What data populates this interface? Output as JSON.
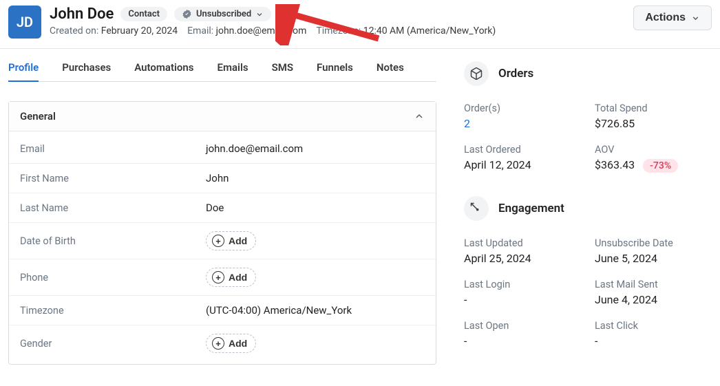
{
  "header": {
    "avatar_initials": "JD",
    "name": "John Doe",
    "badge_contact": "Contact",
    "badge_status": "Unsubscribed",
    "created_label": "Created on:",
    "created_value": "February 20, 2024",
    "email_label": "Email:",
    "email_value": "john.doe@email.com",
    "timezone_label": "Timezone:",
    "timezone_value": "12:40 AM (America/New_York)",
    "actions_label": "Actions"
  },
  "tabs": {
    "profile": "Profile",
    "purchases": "Purchases",
    "automations": "Automations",
    "emails": "Emails",
    "sms": "SMS",
    "funnels": "Funnels",
    "notes": "Notes"
  },
  "general_panel": {
    "title": "General",
    "rows": {
      "email_label": "Email",
      "email_value": "john.doe@email.com",
      "firstname_label": "First Name",
      "firstname_value": "John",
      "lastname_label": "Last Name",
      "lastname_value": "Doe",
      "dob_label": "Date of Birth",
      "phone_label": "Phone",
      "timezone_label": "Timezone",
      "timezone_value": "(UTC-04:00) America/New_York",
      "gender_label": "Gender",
      "add_label": "Add"
    }
  },
  "orders": {
    "section_title": "Orders",
    "orders_label": "Order(s)",
    "orders_value": "2",
    "total_spend_label": "Total Spend",
    "total_spend_value": "$726.85",
    "last_ordered_label": "Last Ordered",
    "last_ordered_value": "April 12, 2024",
    "aov_label": "AOV",
    "aov_value": "$363.43",
    "aov_pct": "-73%"
  },
  "engagement": {
    "section_title": "Engagement",
    "last_updated_label": "Last Updated",
    "last_updated_value": "April 25, 2024",
    "unsub_label": "Unsubscribe Date",
    "unsub_value": "June 5, 2024",
    "last_login_label": "Last Login",
    "last_login_value": "-",
    "last_mail_label": "Last Mail Sent",
    "last_mail_value": "June 4, 2024",
    "last_open_label": "Last Open",
    "last_open_value": "-",
    "last_click_label": "Last Click",
    "last_click_value": "-"
  }
}
